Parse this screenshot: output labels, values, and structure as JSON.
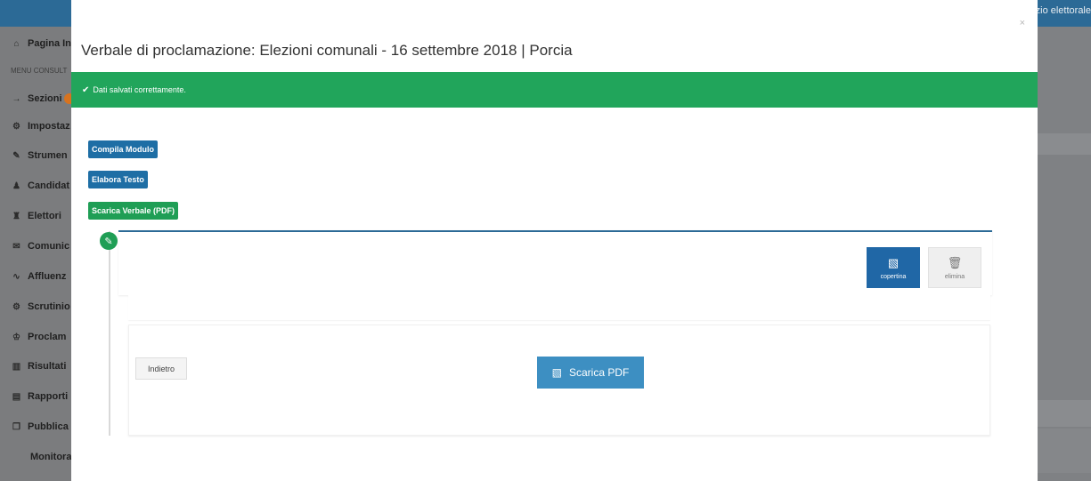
{
  "background_app": {
    "topbar_right_text": "zio elettorale",
    "sidebar": {
      "header": "MENU CONSULT",
      "items": [
        {
          "icon": "home-icon",
          "glyph": "⌂",
          "label": "Pagina In"
        },
        {
          "icon": "sign-in-icon",
          "glyph": "→",
          "label": "Sezioni"
        },
        {
          "icon": "gear-icon",
          "glyph": "⚙",
          "label": "Impostaz"
        },
        {
          "icon": "wrench-icon",
          "glyph": "✎",
          "label": "Strumen"
        },
        {
          "icon": "candidates-icon",
          "glyph": "♟",
          "label": "Candidat"
        },
        {
          "icon": "users-icon",
          "glyph": "♜",
          "label": "Elettori"
        },
        {
          "icon": "envelope-icon",
          "glyph": "✉",
          "label": "Comunic"
        },
        {
          "icon": "line-chart-icon",
          "glyph": "∿",
          "label": "Affluenz"
        },
        {
          "icon": "cogs-icon",
          "glyph": "⚙",
          "label": "Scrutinio"
        },
        {
          "icon": "trophy-icon",
          "glyph": "♔",
          "label": "Proclam"
        },
        {
          "icon": "bar-chart-icon",
          "glyph": "▥",
          "label": "Risultati"
        },
        {
          "icon": "file-icon",
          "glyph": "▤",
          "label": "Rapporti"
        },
        {
          "icon": "copy-icon",
          "glyph": "❐",
          "label": "Pubblica"
        },
        {
          "icon": "",
          "glyph": "",
          "label": "Monitorag"
        }
      ]
    }
  },
  "modal": {
    "close_glyph": "×",
    "title": "Verbale di proclamazione: Elezioni comunali - 16 settembre 2018 | Porcia",
    "alert": {
      "icon": "check-icon",
      "text": "Dati salvati correttamente."
    },
    "steps": [
      {
        "label": "Compila Modulo",
        "color": "#1e6ea5"
      },
      {
        "label": "Elabora Testo",
        "color": "#1e6ea5"
      },
      {
        "label": "Scarica Verbale (PDF)",
        "color": "#1f9e55"
      }
    ],
    "timeline_icon": "pencil-icon",
    "actions": {
      "copertina_label": "copertina",
      "elimina_label": "elimina"
    },
    "footer": {
      "back_label": "Indietro",
      "download_label": "Scarica PDF"
    }
  },
  "colors": {
    "primary": "#2067a6",
    "success": "#21a55b",
    "topbar": "#2c6a96"
  }
}
